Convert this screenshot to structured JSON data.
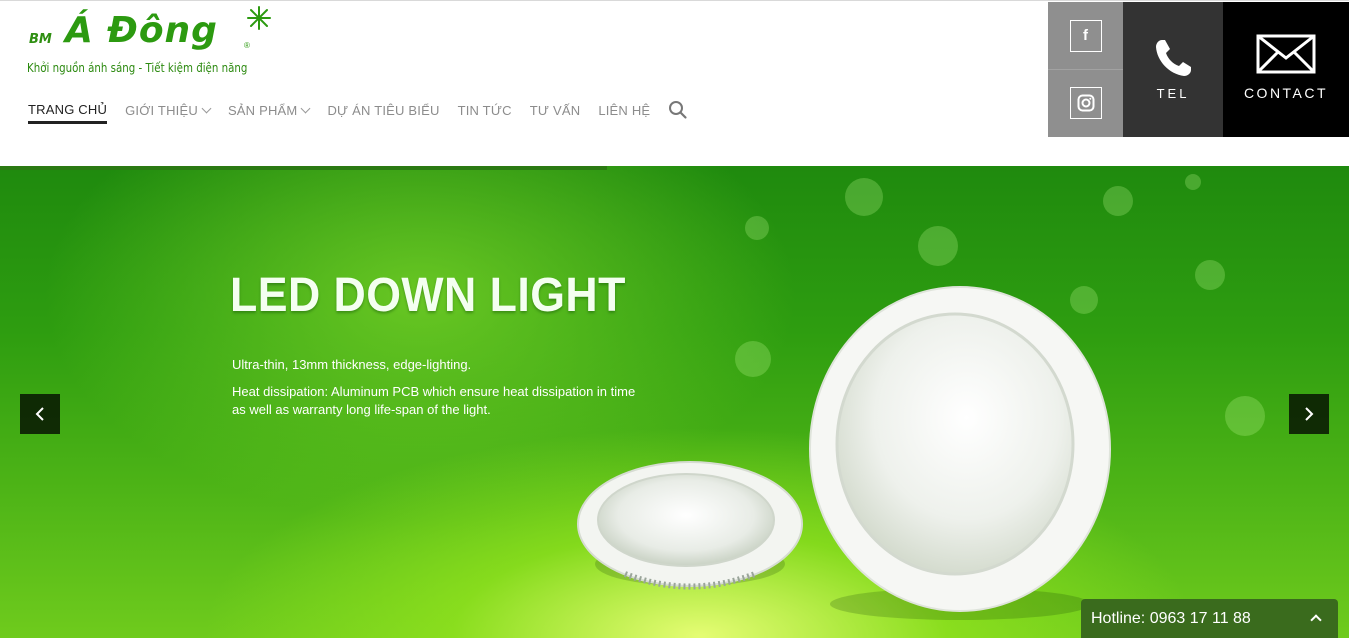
{
  "logo": {
    "prefix": "BM",
    "brand": "Á Đông",
    "registered": "®",
    "slogan": "Khởi nguồn ánh sáng - Tiết kiệm điện năng"
  },
  "nav": {
    "items": [
      {
        "label": "TRANG CHỦ",
        "active": true,
        "dropdown": false
      },
      {
        "label": "GIỚI THIỆU",
        "active": false,
        "dropdown": true
      },
      {
        "label": "SẢN PHẨM",
        "active": false,
        "dropdown": true
      },
      {
        "label": "DỰ ÁN TIÊU BIỂU",
        "active": false,
        "dropdown": false
      },
      {
        "label": "TIN TỨC",
        "active": false,
        "dropdown": false
      },
      {
        "label": "TƯ VẤN",
        "active": false,
        "dropdown": false
      },
      {
        "label": "LIÊN HỆ",
        "active": false,
        "dropdown": false
      }
    ],
    "search_icon": "search-icon"
  },
  "social": {
    "facebook_glyph": "f",
    "facebook_icon": "facebook-icon",
    "instagram_icon": "instagram-icon"
  },
  "tel": {
    "label": "TEL",
    "icon": "phone-icon"
  },
  "contact": {
    "label": "CONTACT",
    "icon": "envelope-icon"
  },
  "slide": {
    "headline": "LED DOWN LIGHT",
    "line1": "Ultra-thin, 13mm thickness, edge-lighting.",
    "line2": "Heat dissipation: Aluminum PCB which ensure heat dissipation in time as well as warranty long life-span of the light."
  },
  "hotline": {
    "text": "Hotline: 0963 17 11 88"
  },
  "colors": {
    "brand_green": "#2c9a10",
    "social_gray": "#8f8f8f",
    "tel_dark": "#333333",
    "contact_black": "#000000",
    "hotline_green": "#3a6b1d"
  }
}
